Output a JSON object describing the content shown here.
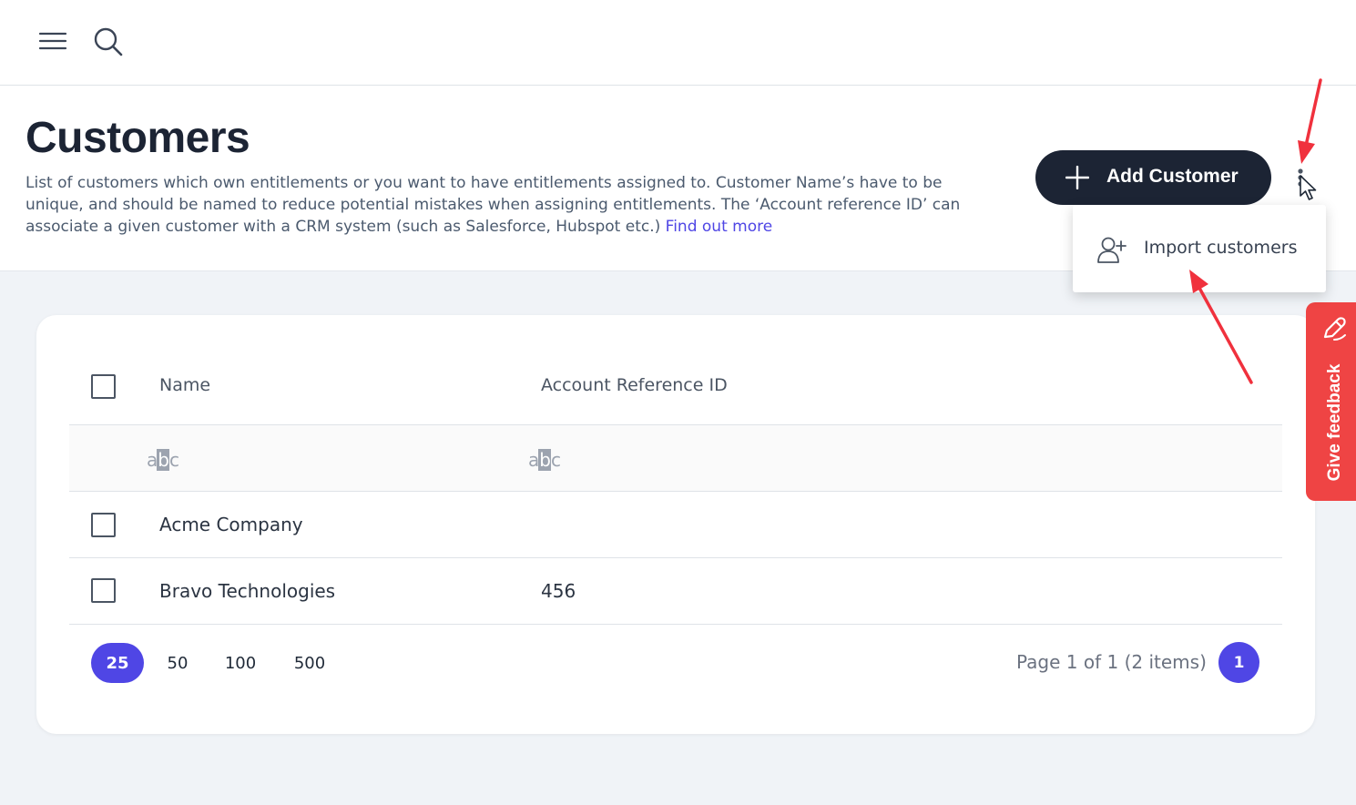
{
  "header": {
    "title": "Customers",
    "description": "List of customers which own entitlements or you want to have entitlements assigned to. Customer Name’s have to be unique, and should be named to reduce potential mistakes when assigning entitlements. The ‘Account reference ID’ can associate a given customer with a CRM system (such as Salesforce, Hubspot etc.)",
    "find_out_more": "Find out more",
    "add_button": "Add Customer"
  },
  "icons": {
    "menu": "hamburger-menu-icon",
    "search": "search-icon",
    "add": "plus-icon",
    "more": "kebab-icon",
    "import": "add-user-icon",
    "feedback": "pen-icon",
    "filter": "abc-text-filter-icon"
  },
  "dropdown": {
    "items": [
      {
        "label": "Import customers"
      }
    ]
  },
  "table": {
    "columns": [
      "Name",
      "Account Reference ID"
    ],
    "filter_placeholder": "abc",
    "rows": [
      {
        "name": "Acme Company",
        "account_ref": ""
      },
      {
        "name": "Bravo Technologies",
        "account_ref": "456"
      }
    ]
  },
  "pagination": {
    "page_sizes": [
      "25",
      "50",
      "100",
      "500"
    ],
    "selected_size": "25",
    "page_info": "Page 1 of 1 (2 items)",
    "current_page": "1"
  },
  "feedback": {
    "label": "Give feedback"
  },
  "colors": {
    "primary": "#4f46e5",
    "dark": "#1c2434",
    "feedback": "#ef4444",
    "annotation": "#f0313d"
  }
}
